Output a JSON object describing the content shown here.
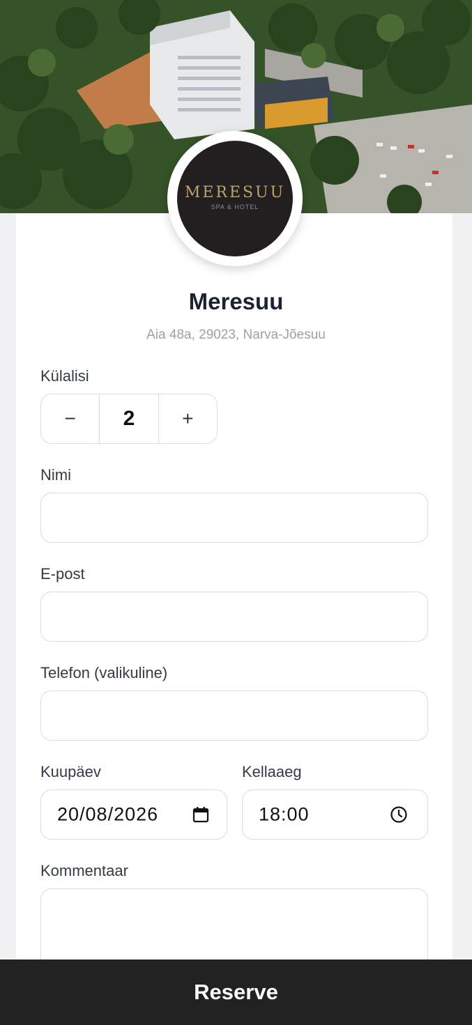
{
  "hotel": {
    "name": "Meresuu",
    "address": "Aia 48a, 29023, Narva-Jõesuu",
    "logo_wordmark": "MERESUU",
    "logo_subtitle": "SPA & HOTEL"
  },
  "form": {
    "guests": {
      "label": "Külalisi",
      "value": "2",
      "decrement": "−",
      "increment": "+"
    },
    "name": {
      "label": "Nimi",
      "value": ""
    },
    "email": {
      "label": "E-post",
      "value": ""
    },
    "phone": {
      "label": "Telefon (valikuline)",
      "value": ""
    },
    "date": {
      "label": "Kuupäev",
      "value": "20/08/2026"
    },
    "time": {
      "label": "Kellaaeg",
      "value": "18:00"
    },
    "comment": {
      "label": "Kommentaar",
      "value": ""
    }
  },
  "actions": {
    "reserve_label": "Reserve"
  },
  "colors": {
    "button_bg": "#222222",
    "logo_disc": "#231f20",
    "logo_gold": "#b9a46a",
    "page_bg": "#f0f1f3"
  },
  "icons": {
    "date": "calendar-icon",
    "time": "clock-icon"
  }
}
